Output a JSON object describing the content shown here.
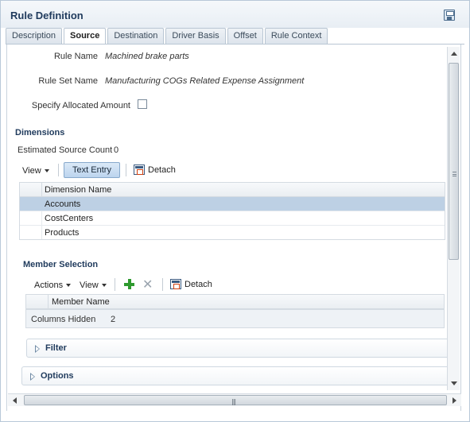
{
  "panel": {
    "title": "Rule Definition",
    "save_icon": "save-disk-icon"
  },
  "tabs": [
    {
      "label": "Description",
      "active": false
    },
    {
      "label": "Source",
      "active": true
    },
    {
      "label": "Destination",
      "active": false
    },
    {
      "label": "Driver Basis",
      "active": false
    },
    {
      "label": "Offset",
      "active": false
    },
    {
      "label": "Rule Context",
      "active": false
    }
  ],
  "form": {
    "rule_name_label": "Rule Name",
    "rule_name_value": "Machined brake parts",
    "rule_set_name_label": "Rule Set Name",
    "rule_set_name_value": "Manufacturing COGs Related Expense Assignment",
    "specify_allocated_label": "Specify Allocated Amount",
    "specify_allocated_checked": false
  },
  "dimensions": {
    "section_title": "Dimensions",
    "estimated_label": "Estimated Source Count",
    "estimated_value": "0",
    "toolbar": {
      "view_label": "View",
      "text_entry_label": "Text Entry",
      "detach_label": "Detach"
    },
    "grid": {
      "column_header": "Dimension Name",
      "rows": [
        {
          "name": "Accounts",
          "selected": true
        },
        {
          "name": "CostCenters",
          "selected": false
        },
        {
          "name": "Products",
          "selected": false
        }
      ]
    }
  },
  "member_selection": {
    "section_title": "Member Selection",
    "toolbar": {
      "actions_label": "Actions",
      "view_label": "View",
      "detach_label": "Detach"
    },
    "grid": {
      "column_header": "Member Name"
    },
    "columns_hidden_label": "Columns Hidden",
    "columns_hidden_count": "2"
  },
  "filter": {
    "title": "Filter"
  },
  "options": {
    "title": "Options"
  },
  "scrollbar": {
    "h_grip": "|||"
  },
  "colors": {
    "title_color": "#1f3a5c",
    "selected_row": "#bdd0e4",
    "text_entry_bg": "#bcd4ee",
    "add_icon": "#2e9a2e"
  }
}
